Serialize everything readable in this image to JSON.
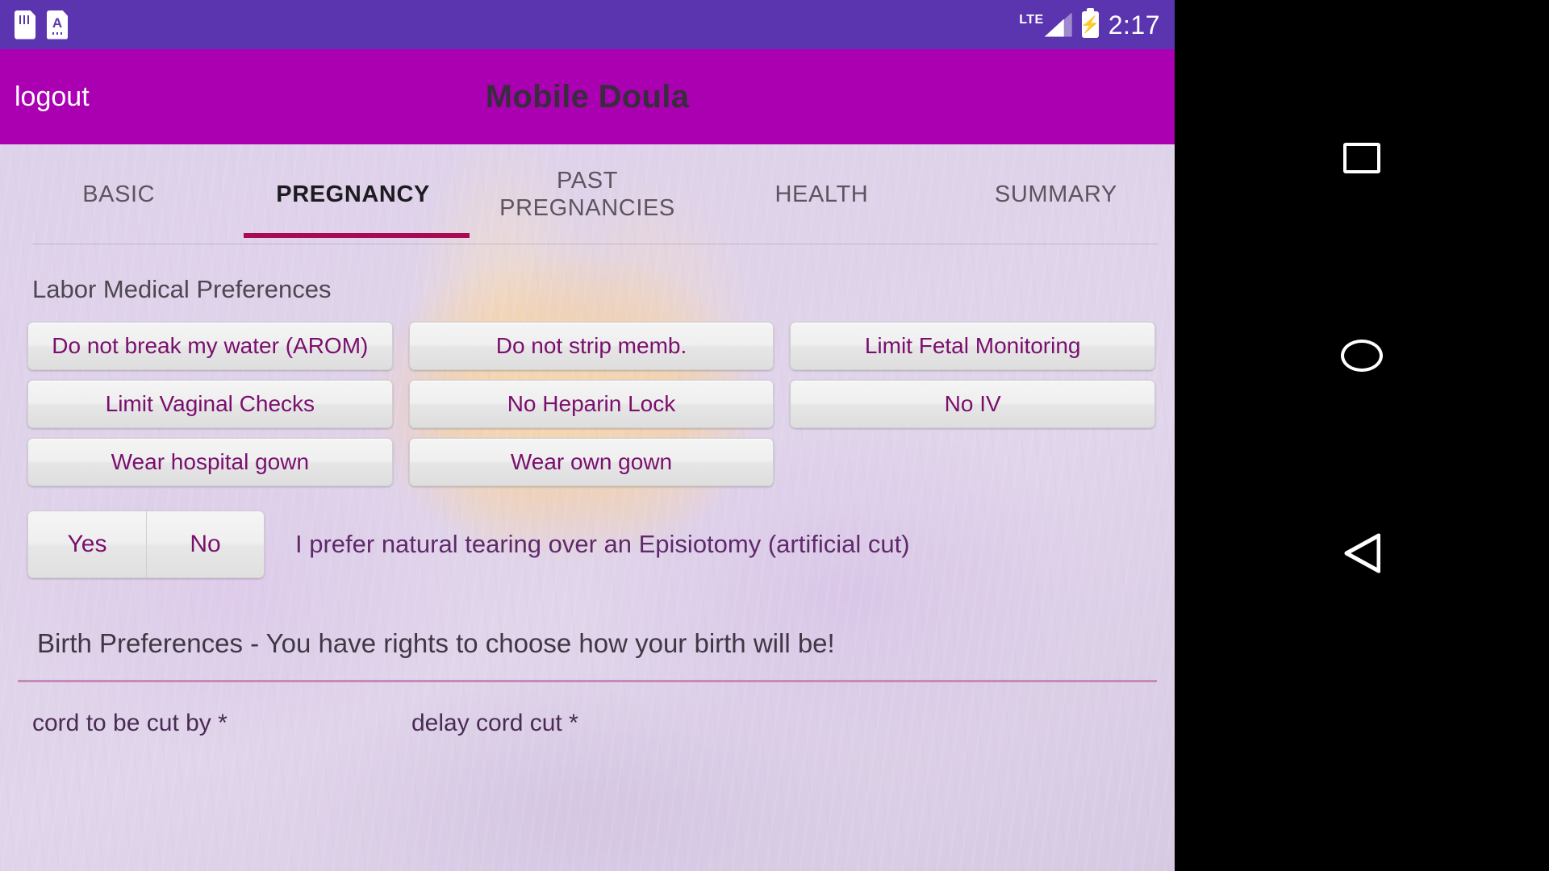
{
  "status_bar": {
    "icons": [
      "sim-card-icon",
      "sim-card-a-icon"
    ],
    "network_label": "LTE",
    "signal_icon": "signal-bars-icon",
    "battery_icon": "battery-charging-icon",
    "clock": "2:17",
    "background_color": "#5b35b0"
  },
  "app_bar": {
    "logout_label": "logout",
    "title": "Mobile Doula",
    "background_color": "#aa00b2",
    "title_color": "#3a2c3f"
  },
  "tabs": {
    "active_index": 1,
    "indicator_color": "#a80b53",
    "items": [
      {
        "label": "BASIC"
      },
      {
        "label": "PREGNANCY"
      },
      {
        "label": "PAST PREGNANCIES"
      },
      {
        "label": "HEALTH"
      },
      {
        "label": "SUMMARY"
      }
    ]
  },
  "labor_section": {
    "heading": "Labor Medical Preferences",
    "buttons": [
      {
        "label": "Do not break my water (AROM)"
      },
      {
        "label": "Do not strip memb."
      },
      {
        "label": "Limit Fetal Monitoring"
      },
      {
        "label": "Limit Vaginal Checks"
      },
      {
        "label": "No Heparin Lock"
      },
      {
        "label": "No IV"
      },
      {
        "label": "Wear hospital gown"
      },
      {
        "label": "Wear own gown"
      },
      {
        "label": ""
      }
    ],
    "button_text_color": "#7a0f6e"
  },
  "episiotomy": {
    "yes_label": "Yes",
    "no_label": "No",
    "statement": "I prefer natural tearing over an Episiotomy (artificial cut)"
  },
  "birth_preferences": {
    "heading": "Birth Preferences - You have rights to choose how your birth will be!",
    "rule_color": "#c48bb9",
    "fields": [
      {
        "label": "cord to be cut by *"
      },
      {
        "label": "delay cord cut *"
      }
    ]
  },
  "nav_bar": {
    "recents_label": "recents",
    "home_label": "home",
    "back_label": "back",
    "background_color": "#000000"
  }
}
